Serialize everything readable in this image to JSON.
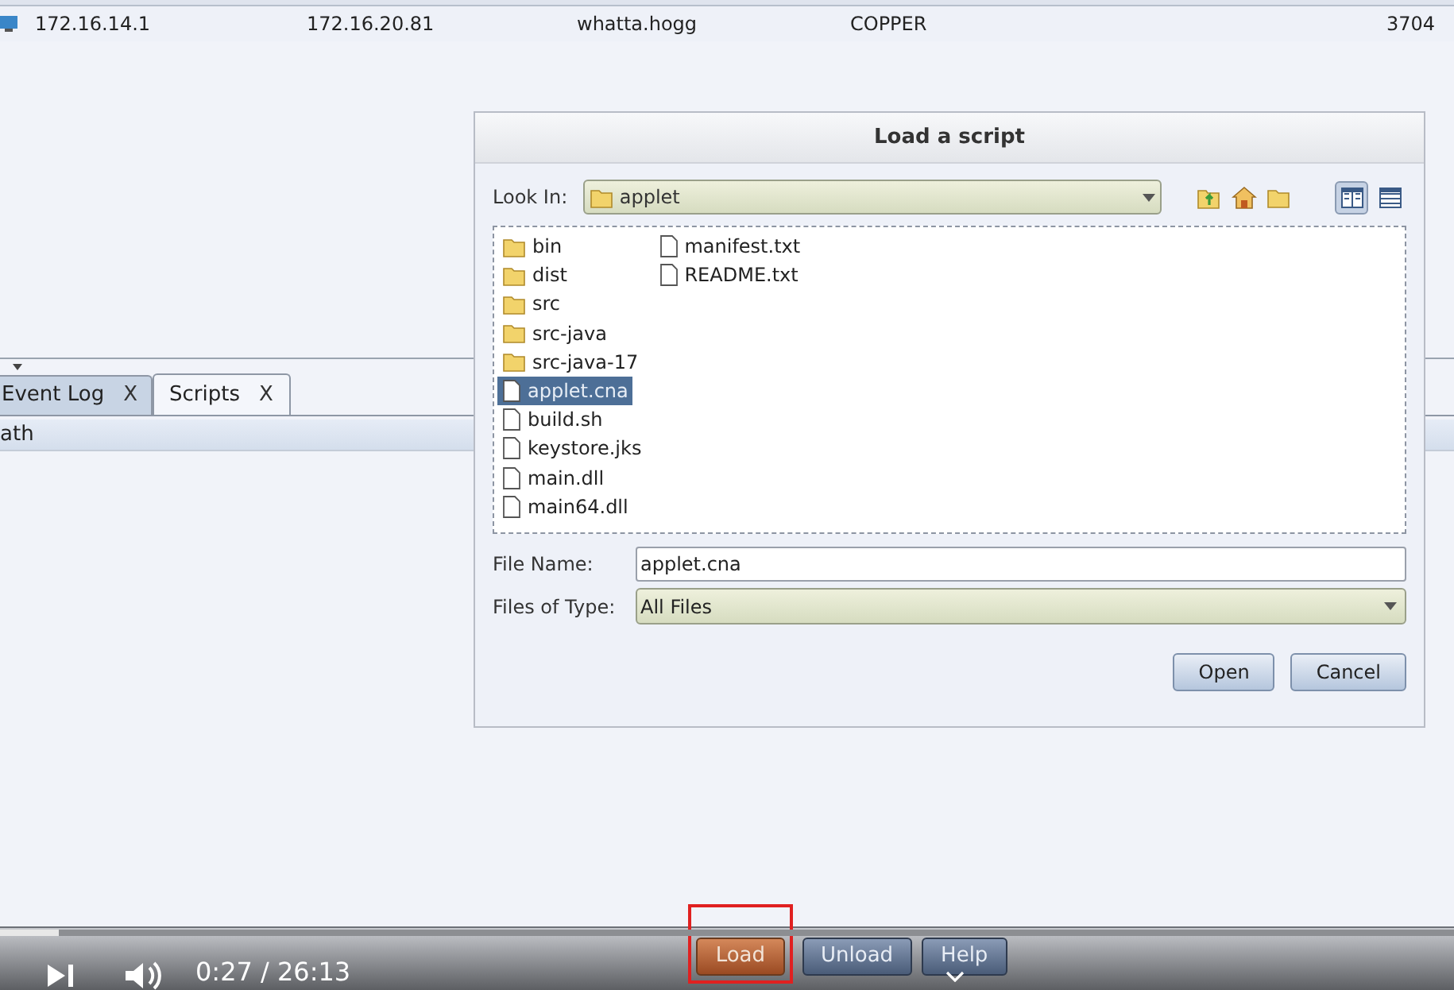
{
  "table_row": {
    "cells": [
      "172.16.14.1",
      "172.16.20.81",
      "whatta.hogg",
      "COPPER",
      "3704"
    ]
  },
  "tabs": [
    {
      "label": "Event Log",
      "close": "X",
      "selected": false
    },
    {
      "label": "Scripts",
      "close": "X",
      "selected": true
    }
  ],
  "scripts_table": {
    "columns": [
      "ath"
    ]
  },
  "buttons": [
    {
      "label": "Load",
      "highlighted": true
    },
    {
      "label": "Unload",
      "highlighted": false
    },
    {
      "label": "Help",
      "highlighted": false
    }
  ],
  "dialog": {
    "title": "Load a script",
    "look_in_label": "Look In:",
    "look_in_value": "applet",
    "view_modes": [
      {
        "kind": "list",
        "selected": true
      },
      {
        "kind": "details",
        "selected": false
      }
    ],
    "files": [
      {
        "name": "bin",
        "kind": "folder",
        "selected": false
      },
      {
        "name": "dist",
        "kind": "folder",
        "selected": false
      },
      {
        "name": "src",
        "kind": "folder",
        "selected": false
      },
      {
        "name": "src-java",
        "kind": "folder",
        "selected": false
      },
      {
        "name": "src-java-17",
        "kind": "folder",
        "selected": false
      },
      {
        "name": "applet.cna",
        "kind": "file",
        "selected": true
      },
      {
        "name": "build.sh",
        "kind": "file",
        "selected": false
      },
      {
        "name": "keystore.jks",
        "kind": "file",
        "selected": false
      },
      {
        "name": "main.dll",
        "kind": "file",
        "selected": false
      },
      {
        "name": "main64.dll",
        "kind": "file",
        "selected": false
      },
      {
        "name": "manifest.txt",
        "kind": "file",
        "selected": false
      },
      {
        "name": "README.txt",
        "kind": "file",
        "selected": false
      }
    ],
    "file_name_label": "File Name:",
    "file_name_value": "applet.cna",
    "file_type_label": "Files of Type:",
    "file_type_value": "All Files",
    "actions": [
      "Open",
      "Cancel"
    ]
  },
  "video_player": {
    "time": "0:27 / 26:13",
    "level": 0.04
  }
}
